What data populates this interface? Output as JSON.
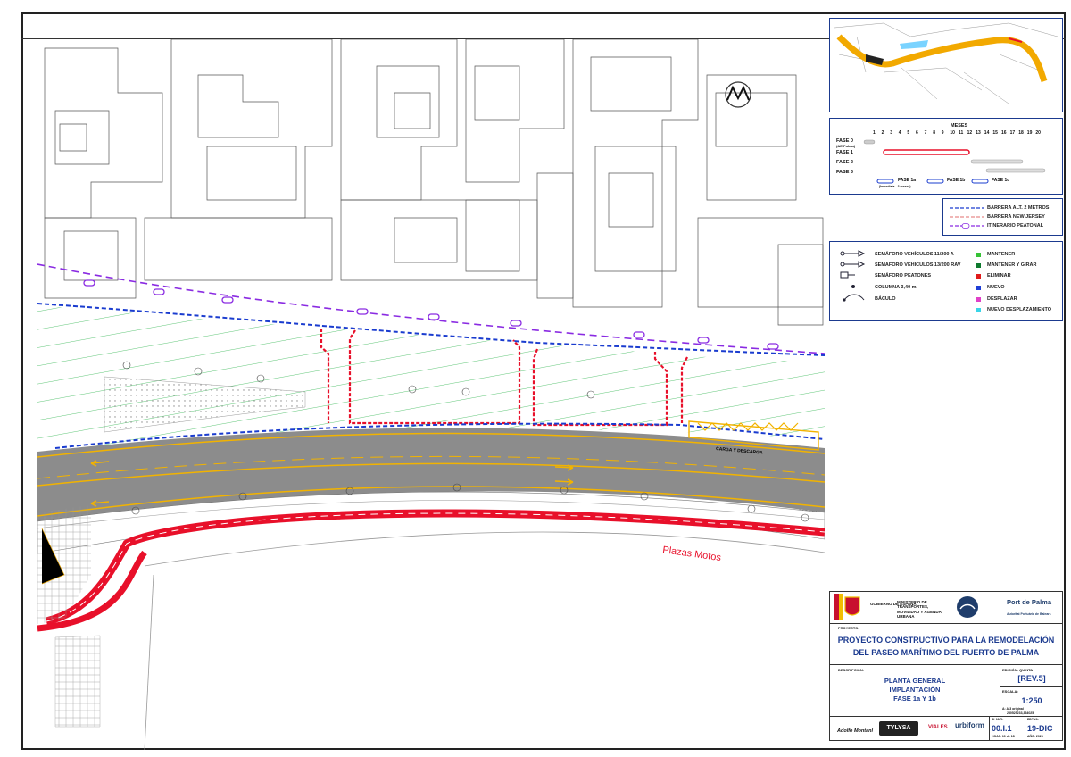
{
  "map": {
    "label_plazas_motos": "Plazas Motos",
    "label_carga_descarga_1": "CARGA Y DESCARGA",
    "label_carga_descarga_2": "CARGA Y DESC"
  },
  "schedule": {
    "header": "MESES",
    "months": [
      "1",
      "2",
      "3",
      "4",
      "5",
      "6",
      "7",
      "8",
      "9",
      "10",
      "11",
      "12",
      "13",
      "14",
      "15",
      "16",
      "17",
      "18",
      "19",
      "20"
    ],
    "phases": [
      {
        "label": "FASE 0",
        "sublabel": "(AE Palma)"
      },
      {
        "label": "FASE 1"
      },
      {
        "label": "FASE 2"
      },
      {
        "label": "FASE 3"
      }
    ],
    "sub_legend": [
      {
        "label": "FASE 1a",
        "note": "(Inmediata - 3 meses)"
      },
      {
        "label": "FASE 1b"
      },
      {
        "label": "FASE 1c"
      }
    ]
  },
  "barrier_legend": [
    {
      "label": "BARRERA ALT. 2 METROS",
      "color": "#1a3ccf"
    },
    {
      "label": "BARRERA NEW JERSEY",
      "color": "#e68a8a"
    },
    {
      "label": "ITINERARIO PEATONAL",
      "color": "#8a2be2"
    }
  ],
  "elements_legend": {
    "left": [
      {
        "label": "SEMÁFORO VEHÍCULOS 11/200 A"
      },
      {
        "label": "SEMÁFORO VEHÍCULOS 13/200 RAV"
      },
      {
        "label": "SEMÁFORO PEATONES"
      },
      {
        "label": "COLUMNA 3,40 m."
      },
      {
        "label": "BÁCULO"
      }
    ],
    "right": [
      {
        "label": "MANTENER",
        "color": "#36c236"
      },
      {
        "label": "MANTENER Y GIRAR",
        "color": "#0e7a2e"
      },
      {
        "label": "ELIMINAR",
        "color": "#e01b1b"
      },
      {
        "label": "NUEVO",
        "color": "#1f3fd6"
      },
      {
        "label": "DESPLAZAR",
        "color": "#e040c8"
      },
      {
        "label": "NUEVO DESPLAZAMIENTO",
        "color": "#39d5e8"
      }
    ]
  },
  "title_block": {
    "gov_1": "GOBIERNO DE ESPAÑA",
    "gov_2": "MINISTERIO DE TRANSPORTES, MOVILIDAD Y AGENDA URBANA",
    "port": "Port de Palma",
    "port_sub": "Autoritat Portuària de Balears",
    "proyecto_label": "PROYECTO:",
    "project_title_1": "PROYECTO CONSTRUCTIVO PARA LA REMODELACIÓN",
    "project_title_2": "DEL PASEO MARÍTIMO DEL PUERTO DE PALMA",
    "descripcion_label": "DESCRIPCIÓN:",
    "desc_1": "PLANTA GENERAL",
    "desc_2": "IMPLANTACIÓN",
    "desc_3": "FASE 1a Y 1b",
    "edicion_label": "EDICIÓN: QUINTA",
    "revision": "[REV.5]",
    "escala_label": "ESCALA:",
    "escala": "1:250",
    "escala_note": "A: A-3 original",
    "file_ref": "230525233,334025",
    "plano_label": "PLANO:",
    "plano": "00.I.1",
    "hoja": "HOJA: 10 de 18",
    "fecha_label": "FECHA:",
    "fecha": "19-DIC",
    "anio": "AÑO: 2023",
    "logo_1": "Adolfo Montanl",
    "logo_2": "TYLYSA",
    "logo_3": "VIALES",
    "logo_4": "urbiform"
  },
  "colors": {
    "road": "#8c8c8c",
    "road_line": "#f2b300",
    "bike_lane": "#e8102a",
    "hatch": "#29b34a",
    "barrier_blue": "#1a3ccf",
    "pedestrian": "#8a2be2",
    "fence_red": "#e8102a",
    "frame_blue": "#1b3a8f"
  },
  "icons": {
    "north_arrow": "north-arrow-icon",
    "gov_shield": "coat-of-arms-icon",
    "port_logo": "port-logo-icon"
  }
}
